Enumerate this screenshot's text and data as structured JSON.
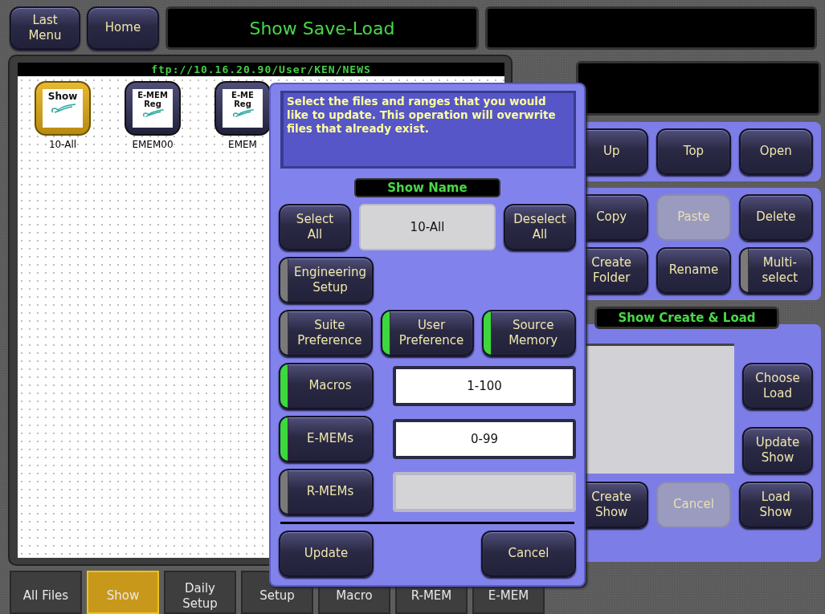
{
  "top_bar": {
    "buttons": [
      {
        "label": "Last\nMenu"
      },
      {
        "label": "Home"
      }
    ],
    "title": "Show Save-Load"
  },
  "file_browser": {
    "path": "ftp://10.16.20.90/User/KEN/NEWS",
    "files": [
      {
        "icon_lines": [
          "Show"
        ],
        "name": "10-All",
        "selected": true,
        "kind": "show"
      },
      {
        "icon_lines": [
          "E-MEM",
          "Reg"
        ],
        "name": "EMEM00",
        "selected": false,
        "kind": "emem"
      },
      {
        "icon_lines": [
          "E-ME",
          "Reg"
        ],
        "name": "EMEM",
        "selected": false,
        "kind": "emem"
      }
    ]
  },
  "file_operations": {
    "navigation": [
      {
        "label": "Up",
        "disabled": false
      },
      {
        "label": "Top",
        "disabled": false
      },
      {
        "label": "Open",
        "disabled": false
      }
    ],
    "edit": [
      {
        "label": "Copy",
        "disabled": false,
        "kind": "plain"
      },
      {
        "label": "Paste",
        "disabled": true,
        "kind": "plain"
      },
      {
        "label": "Delete",
        "disabled": false,
        "kind": "plain"
      },
      {
        "label": "Create\nFolder",
        "disabled": false,
        "kind": "plain"
      },
      {
        "label": "Rename",
        "disabled": false,
        "kind": "plain"
      },
      {
        "label": "Multi-\nselect",
        "disabled": false,
        "kind": "toggle",
        "on": false
      }
    ]
  },
  "show_create_load": {
    "title": "Show Create & Load",
    "side_buttons": [
      {
        "label": "Choose\nLoad",
        "disabled": false
      },
      {
        "label": "Update\nShow",
        "disabled": false
      }
    ],
    "bottom_buttons": [
      {
        "label": "Create\nShow",
        "disabled": false
      },
      {
        "label": "Cancel",
        "disabled": true
      },
      {
        "label": "Load\nShow",
        "disabled": false
      }
    ]
  },
  "bottom_tabs": [
    {
      "label": "All Files",
      "selected": false
    },
    {
      "label": "Show",
      "selected": true
    },
    {
      "label": "Daily\nSetup",
      "selected": false
    },
    {
      "label": "Setup",
      "selected": false
    },
    {
      "label": "Macro",
      "selected": false
    },
    {
      "label": "R-MEM",
      "selected": false
    },
    {
      "label": "E-MEM",
      "selected": false
    }
  ],
  "dialog": {
    "message": "Select the files and ranges that you would like to update. This operation will overwrite files that already exist.",
    "show_name_label": "Show Name",
    "show_name_value": "10-All",
    "select_all": "Select\nAll",
    "deselect_all": "Deselect\nAll",
    "engineering": {
      "label": "Engineering\nSetup",
      "on": false
    },
    "preferences": [
      {
        "label": "Suite\nPreference",
        "on": false
      },
      {
        "label": "User\nPreference",
        "on": true
      },
      {
        "label": "Source\nMemory",
        "on": true
      }
    ],
    "ranges": [
      {
        "label": "Macros",
        "on": true,
        "value": "1-100",
        "disabled": false
      },
      {
        "label": "E-MEMs",
        "on": true,
        "value": "0-99",
        "disabled": false
      },
      {
        "label": "R-MEMs",
        "on": false,
        "disabled": true
      }
    ],
    "buttons": [
      "Update",
      "Cancel"
    ]
  }
}
